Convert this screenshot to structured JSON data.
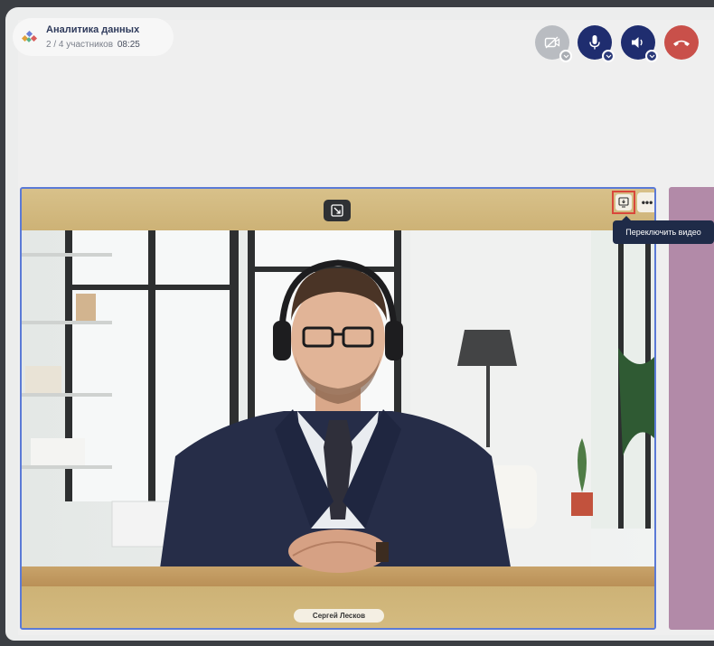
{
  "meeting": {
    "title": "Аналитика данных",
    "participants": "2 / 4 участников",
    "time": "08:25"
  },
  "controls": {
    "video": {
      "icon": "camera-off-icon",
      "state": "off"
    },
    "mic": {
      "icon": "microphone-icon"
    },
    "speaker": {
      "icon": "speaker-icon"
    },
    "hangup": {
      "icon": "hangup-icon"
    }
  },
  "tile": {
    "participant_name": "Сергей Лесков",
    "more_label": "•••",
    "tooltip": "Переключить видео"
  },
  "colors": {
    "accent": "#1f2d6f",
    "hangup": "#c9504a",
    "tile_frame": "#cfb57a",
    "tile_border": "#5b7ad6",
    "highlight": "#d9473b",
    "side_tile": "#b28aa8"
  }
}
